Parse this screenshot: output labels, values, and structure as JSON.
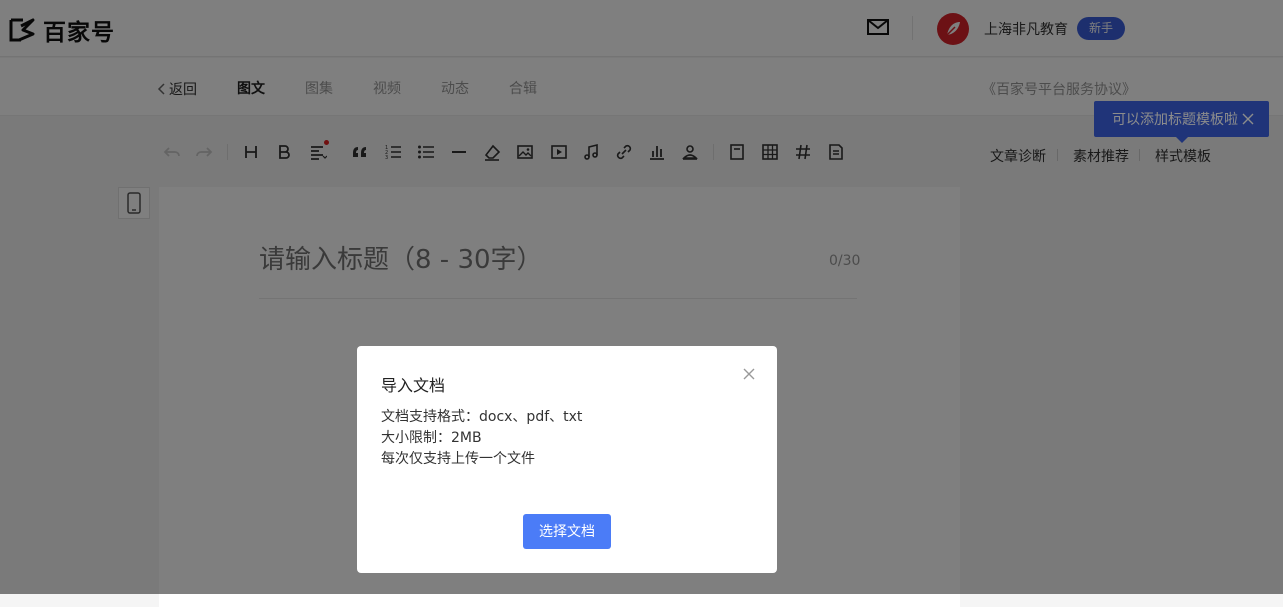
{
  "header": {
    "logo_text": "百家号",
    "logo_icon": "baijiahao-logo-icon",
    "mail_icon": "mail-icon",
    "avatar_icon": "user-avatar-icon",
    "username": "上海非凡教育",
    "badge": "新手",
    "brand_color": "#3a5fdc"
  },
  "subnav": {
    "back": "返回",
    "tabs": [
      {
        "label": "图文",
        "active": true
      },
      {
        "label": "图集",
        "active": false
      },
      {
        "label": "视频",
        "active": false
      },
      {
        "label": "动态",
        "active": false
      },
      {
        "label": "合辑",
        "active": false
      }
    ],
    "agreement": "《百家号平台服务协议》"
  },
  "tooltip": {
    "text": "可以添加标题模板啦"
  },
  "toolbar": {
    "icons": [
      "undo-icon",
      "redo-icon",
      "heading-icon",
      "bold-icon",
      "align-icon",
      "quote-icon",
      "ordered-list-icon",
      "unordered-list-icon",
      "horizontal-rule-icon",
      "clear-format-icon",
      "image-icon",
      "video-icon",
      "audio-icon",
      "link-icon",
      "chart-icon",
      "user-card-icon",
      "article-icon",
      "table-icon",
      "hashtag-icon",
      "document-import-icon"
    ]
  },
  "side_tools": {
    "diagnose": "文章诊断",
    "material": "素材推荐",
    "template": "样式模板"
  },
  "editor": {
    "title_placeholder": "请输入标题（8 - 30字）",
    "counter": "0/30"
  },
  "modal": {
    "title": "导入文档",
    "formats": "文档支持格式：docx、pdf、txt",
    "size_limit": "大小限制：2MB",
    "once": "每次仅支持上传一个文件",
    "button": "选择文档",
    "button_color": "#4b7cf7"
  }
}
